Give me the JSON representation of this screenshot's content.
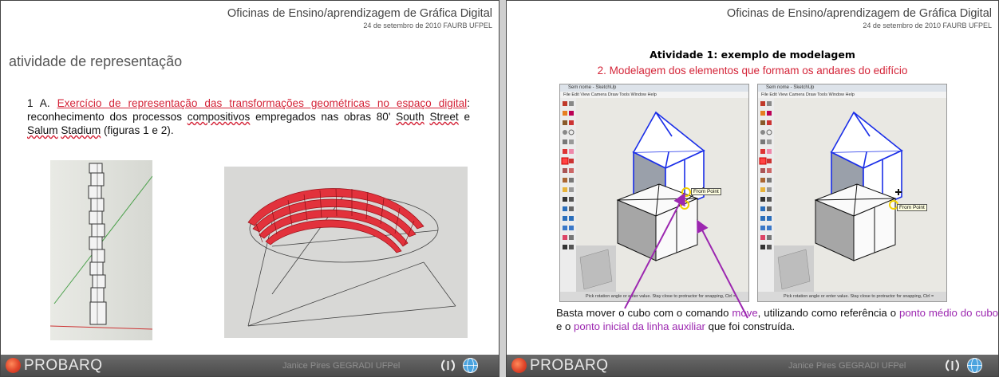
{
  "header": {
    "title": "Oficinas de Ensino/aprendizagem de Gráfica Digital",
    "subtitle": "24 de setembro de 2010 FAURB UFPEL"
  },
  "footer": {
    "logo": "PROBARQ",
    "credit": "Janice Pires   GEGRADI  UFPel"
  },
  "slide1": {
    "section_title": "atividade de representação",
    "item_number": "1 A.",
    "item_link": "Exercício de representação das transformações geométricas no espaço digital",
    "item_text_a": ": reconhecimento dos processos ",
    "item_word_wavy": "compositivos",
    "item_text_b": " empregados nas obras 80' ",
    "item_word_south": "South",
    "item_space1": " ",
    "item_word_street": "Street",
    "item_text_c": " e ",
    "item_word_salum": "Salum",
    "item_space2": " ",
    "item_word_stadium": "Stadium",
    "item_text_d": " (figuras 1 e 2)."
  },
  "slide2": {
    "title": "Atividade 1: exemplo de modelagem",
    "subtitle": "2. Modelagem dos elementos que formam os andares do edifício",
    "window_title": "Sem nome - SketchUp",
    "menu": "File  Edit  View  Camera  Draw  Tools  Window  Help",
    "status": "Pick rotation angle or enter value.  Stay close to protractor for snapping, Ctrl =",
    "tooltip": "From Point",
    "caption_a": "Basta mover o cubo com o comando ",
    "caption_move": "move",
    "caption_b": ", utilizando como referência o ",
    "caption_mid": "ponto médio do cubo",
    "caption_c": " e o ",
    "caption_start": "ponto inicial da linha auxiliar",
    "caption_d": " que foi construída."
  },
  "icons": {
    "logo": "probarq-logo-circle",
    "footer_icons": [
      "ufpel-logo-icon",
      "gegradi-globe-icon"
    ],
    "tooltip_marker": "yellow-circle-icon"
  },
  "colors": {
    "accent_red": "#d42438",
    "accent_purple": "#9c27b0",
    "footer_bg": "#555555"
  }
}
